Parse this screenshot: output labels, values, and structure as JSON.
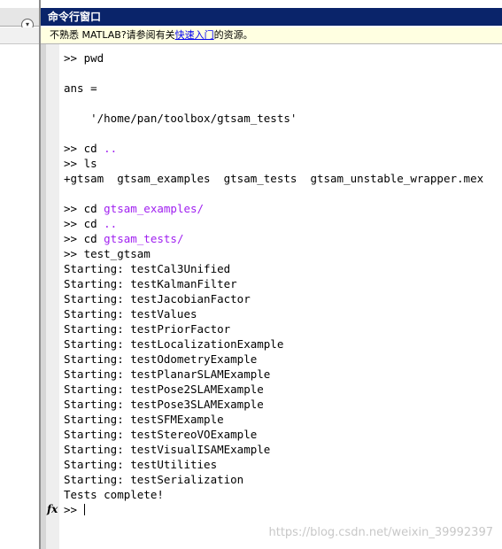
{
  "command_window": {
    "title": "命令行窗口",
    "info_prefix": "不熟悉 MATLAB?请参阅有关",
    "info_link": "快速入门",
    "info_suffix": "的资源。"
  },
  "console": {
    "lines": [
      {
        "prompt": ">> ",
        "text": "pwd",
        "highlight": ""
      },
      {
        "prompt": "",
        "text": "",
        "highlight": ""
      },
      {
        "prompt": "",
        "text": "ans =",
        "highlight": ""
      },
      {
        "prompt": "",
        "text": "",
        "highlight": ""
      },
      {
        "prompt": "",
        "text": "    '/home/pan/toolbox/gtsam_tests'",
        "highlight": ""
      },
      {
        "prompt": "",
        "text": "",
        "highlight": ""
      },
      {
        "prompt": ">> ",
        "text": "cd ",
        "highlight": ".."
      },
      {
        "prompt": ">> ",
        "text": "ls",
        "highlight": ""
      },
      {
        "prompt": "",
        "text": "+gtsam  gtsam_examples  gtsam_tests  gtsam_unstable_wrapper.mex",
        "highlight": ""
      },
      {
        "prompt": "",
        "text": "",
        "highlight": ""
      },
      {
        "prompt": ">> ",
        "text": "cd ",
        "highlight": "gtsam_examples/"
      },
      {
        "prompt": ">> ",
        "text": "cd ",
        "highlight": ".."
      },
      {
        "prompt": ">> ",
        "text": "cd ",
        "highlight": "gtsam_tests/"
      },
      {
        "prompt": ">> ",
        "text": "test_gtsam",
        "highlight": ""
      },
      {
        "prompt": "",
        "text": "Starting: testCal3Unified",
        "highlight": ""
      },
      {
        "prompt": "",
        "text": "Starting: testKalmanFilter",
        "highlight": ""
      },
      {
        "prompt": "",
        "text": "Starting: testJacobianFactor",
        "highlight": ""
      },
      {
        "prompt": "",
        "text": "Starting: testValues",
        "highlight": ""
      },
      {
        "prompt": "",
        "text": "Starting: testPriorFactor",
        "highlight": ""
      },
      {
        "prompt": "",
        "text": "Starting: testLocalizationExample",
        "highlight": ""
      },
      {
        "prompt": "",
        "text": "Starting: testOdometryExample",
        "highlight": ""
      },
      {
        "prompt": "",
        "text": "Starting: testPlanarSLAMExample",
        "highlight": ""
      },
      {
        "prompt": "",
        "text": "Starting: testPose2SLAMExample",
        "highlight": ""
      },
      {
        "prompt": "",
        "text": "Starting: testPose3SLAMExample",
        "highlight": ""
      },
      {
        "prompt": "",
        "text": "Starting: testSFMExample",
        "highlight": ""
      },
      {
        "prompt": "",
        "text": "Starting: testStereoVOExample",
        "highlight": ""
      },
      {
        "prompt": "",
        "text": "Starting: testVisualISAMExample",
        "highlight": ""
      },
      {
        "prompt": "",
        "text": "Starting: testUtilities",
        "highlight": ""
      },
      {
        "prompt": "",
        "text": "Starting: testSerialization",
        "highlight": ""
      },
      {
        "prompt": "",
        "text": "Tests complete!",
        "highlight": ""
      }
    ],
    "active_prompt": ">> ",
    "fx_label": "fx"
  },
  "watermark": "https://blog.csdn.net/weixin_39992397",
  "colors": {
    "titlebar": "#0a246a",
    "infobar": "#ffffe1",
    "string_highlight": "#a020f0"
  }
}
